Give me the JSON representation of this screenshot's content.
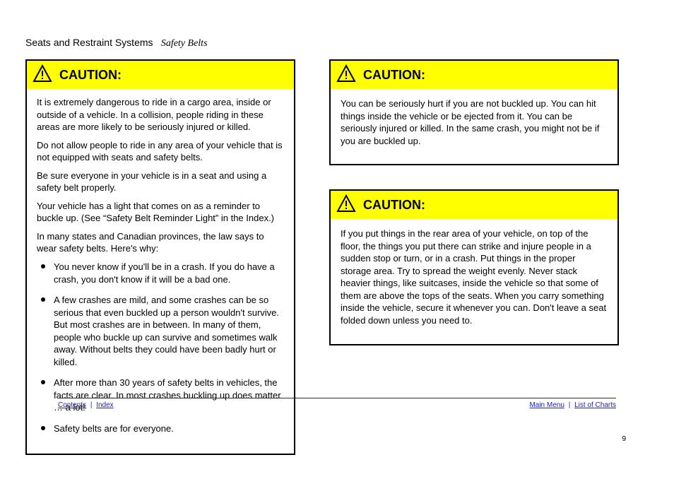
{
  "header": {
    "section": "Seats and Restraint Systems",
    "subsection": "Safety Belts",
    "page_number": "9"
  },
  "caution_left": {
    "label": "CAUTION:",
    "intro1": "It is extremely dangerous to ride in a cargo area, inside or outside of a vehicle. In a collision, people riding in these areas are more likely to be seriously injured or killed.",
    "intro2": "Do not allow people to ride in any area of your vehicle that is not equipped with seats and safety belts.",
    "intro3": "Be sure everyone in your vehicle is in a seat and using a safety belt properly.",
    "intro4": "Your vehicle has a light that comes on as a reminder to buckle up. (See “Safety Belt Reminder Light” in the Index.)",
    "intro5": "In many states and Canadian provinces, the law says to wear safety belts. Here's why:",
    "bullets": [
      "You never know if you'll be in a crash. If you do have a crash, you don't know if it will be a bad one.",
      "A few crashes are mild, and some crashes can be so serious that even buckled up a person wouldn't survive. But most crashes are in between. In many of them, people who buckle up can survive and sometimes walk away. Without belts they could have been badly hurt or killed.",
      "After more than 30 years of safety belts in vehicles, the facts are clear. In most crashes buckling up does matter … a lot!",
      "Safety belts are for everyone."
    ]
  },
  "caution_right_1": {
    "label": "CAUTION:",
    "body": "You can be seriously hurt if you are not buckled up. You can hit things inside the vehicle or be ejected from it. You can be seriously injured or killed. In the same crash, you might not be if you are buckled up."
  },
  "caution_right_2": {
    "label": "CAUTION:",
    "body": "If you put things in the rear area of your vehicle, on top of the floor, the things you put there can strike and injure people in a sudden stop or turn, or in a crash.\nPut things in the proper storage area. Try to spread the weight evenly.\nNever stack heavier things, like suitcases, inside the vehicle so that some of them are above the tops of the seats.\nWhen you carry something inside the vehicle, secure it whenever you can.\nDon't leave a seat folded down unless you need to."
  },
  "footer": {
    "left_links": [
      "Contents",
      "Index"
    ],
    "right_links": [
      "Main Menu",
      "List of Charts"
    ]
  }
}
